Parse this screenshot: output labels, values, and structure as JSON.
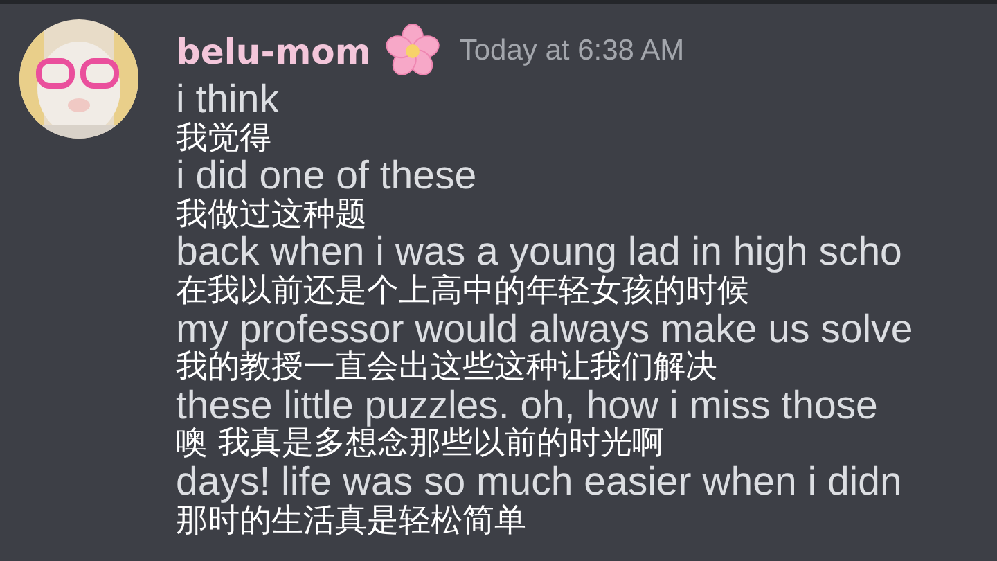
{
  "message": {
    "author": "belu-mom",
    "timestamp": "Today at 6:38 AM",
    "lines": [
      {
        "kind": "text",
        "text": "i think"
      },
      {
        "kind": "subtitle",
        "text": "我觉得"
      },
      {
        "kind": "text",
        "text": "i did one of these"
      },
      {
        "kind": "subtitle",
        "text": "我做过这种题"
      },
      {
        "kind": "text",
        "text": "back when i was a young lad in high scho"
      },
      {
        "kind": "subtitle",
        "text": "在我以前还是个上高中的年轻女孩的时候"
      },
      {
        "kind": "text",
        "text": "my professor would always make us solve"
      },
      {
        "kind": "subtitle",
        "text": "我的教授一直会出这些这种让我们解决"
      },
      {
        "kind": "text",
        "text": "these little puzzles. oh, how i miss those"
      },
      {
        "kind": "subtitle",
        "text": "噢  我真是多想念那些以前的时光啊"
      },
      {
        "kind": "text",
        "text": "days! life was so much easier when i didn"
      },
      {
        "kind": "subtitle",
        "text": "那时的生活真是轻松简单"
      }
    ]
  }
}
